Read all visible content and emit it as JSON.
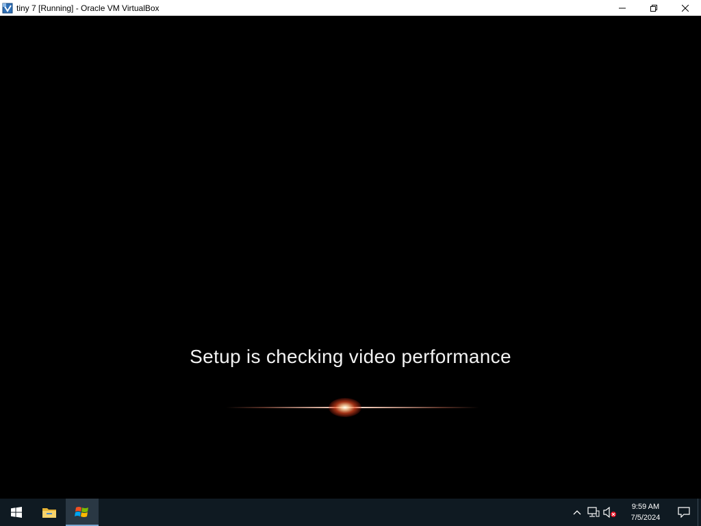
{
  "window": {
    "title": "tiny 7 [Running] - Oracle VM VirtualBox",
    "icon": "virtualbox-icon",
    "controls": [
      "minimize-icon",
      "restore-icon",
      "close-icon"
    ]
  },
  "vm": {
    "message": "Setup is checking video performance",
    "background_color": "#000000",
    "glow_color": "#ff6a3d"
  },
  "taskbar": {
    "background_color": "#0f1a22",
    "apps": [
      {
        "name": "Start",
        "icon": "windows-start-icon",
        "active": false
      },
      {
        "name": "File Explorer",
        "icon": "folder-icon",
        "active": false
      },
      {
        "name": "VirtualBox VM",
        "icon": "windows7-flag-icon",
        "active": true
      }
    ],
    "tray": {
      "icons": [
        "chevron-up-icon",
        "network-icon",
        "volume-muted-icon"
      ],
      "time": "9:59 AM",
      "date": "7/5/2024",
      "notification_icon": "action-center-icon"
    }
  }
}
